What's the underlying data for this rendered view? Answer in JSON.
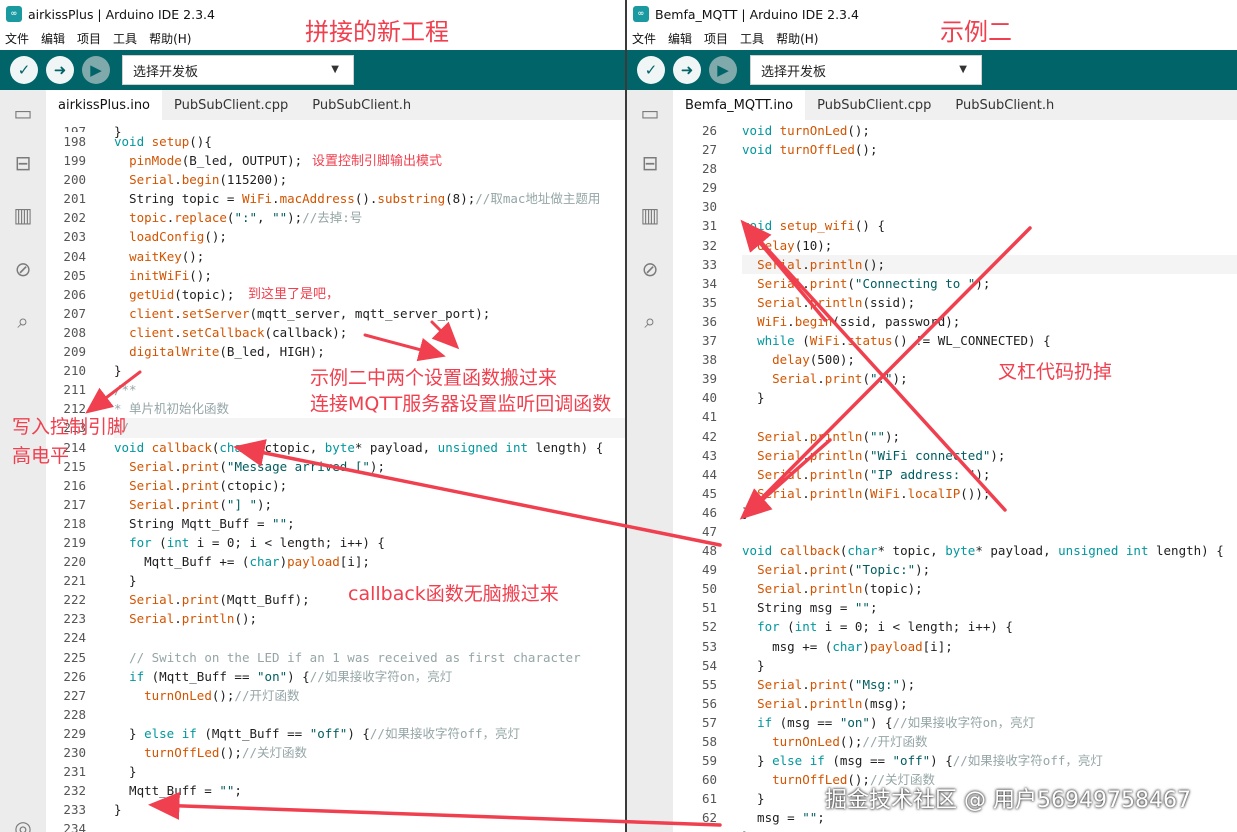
{
  "left_window": {
    "title": "airkissPlus | Arduino IDE 2.3.4",
    "menu": [
      "文件",
      "编辑",
      "项目",
      "工具",
      "帮助(H)"
    ],
    "board_selector": "选择开发板",
    "tabs": [
      "airkissPlus.ino",
      "PubSubClient.cpp",
      "PubSubClient.h"
    ],
    "active_tab": 0,
    "first_partial_line": "197",
    "lines": [
      {
        "n": "198",
        "html": "<span class=\"ty\">void</span> <span class=\"fn\">setup</span>(){"
      },
      {
        "n": "199",
        "html": "  <span class=\"fn\">pinMode</span>(B_led, OUTPUT);"
      },
      {
        "n": "200",
        "html": "  <span class=\"fn\">Serial</span>.<span class=\"fn\">begin</span>(115200);"
      },
      {
        "n": "201",
        "html": "  String topic = <span class=\"fn\">WiFi</span>.<span class=\"fn\">macAddress</span>().<span class=\"fn\">substring</span>(8);<span class=\"cm\">//取mac地址做主题用</span>"
      },
      {
        "n": "202",
        "html": "  <span class=\"fn\">topic</span>.<span class=\"fn\">replace</span>(<span class=\"st\">\":\"</span>, <span class=\"st\">\"\"</span>);<span class=\"cm\">//去掉:号</span>"
      },
      {
        "n": "203",
        "html": "  <span class=\"fn\">loadConfig</span>();"
      },
      {
        "n": "204",
        "html": "  <span class=\"fn\">waitKey</span>();"
      },
      {
        "n": "205",
        "html": "  <span class=\"fn\">initWiFi</span>();"
      },
      {
        "n": "206",
        "html": "  <span class=\"fn\">getUid</span>(topic);"
      },
      {
        "n": "207",
        "html": "  <span class=\"fn\">client</span>.<span class=\"fn\">setServer</span>(mqtt_server, mqtt_server_port);"
      },
      {
        "n": "208",
        "html": "  <span class=\"fn\">client</span>.<span class=\"fn\">setCallback</span>(callback);"
      },
      {
        "n": "209",
        "html": "  <span class=\"fn\">digitalWrite</span>(B_led, HIGH);"
      },
      {
        "n": "210",
        "html": "}"
      },
      {
        "n": "211",
        "html": "<span class=\"cm\">/**</span>"
      },
      {
        "n": "212",
        "html": "<span class=\"cm\">* 单片机初始化函数</span>"
      },
      {
        "n": "213",
        "html": "<span class=\"cm\">*/</span>"
      },
      {
        "n": "214",
        "html": "<span class=\"ty\">void</span> <span class=\"fn\">callback</span>(<span class=\"ty\">char</span>* ctopic, <span class=\"ty\">byte</span>* payload, <span class=\"ty\">unsigned</span> <span class=\"ty\">int</span> length) {"
      },
      {
        "n": "215",
        "html": "  <span class=\"fn\">Serial</span>.<span class=\"fn\">print</span>(<span class=\"st\">\"Message arrived [\"</span>);"
      },
      {
        "n": "216",
        "html": "  <span class=\"fn\">Serial</span>.<span class=\"fn\">print</span>(ctopic);"
      },
      {
        "n": "217",
        "html": "  <span class=\"fn\">Serial</span>.<span class=\"fn\">print</span>(<span class=\"st\">\"] \"</span>);"
      },
      {
        "n": "218",
        "html": "  String Mqtt_Buff = <span class=\"st\">\"\"</span>;"
      },
      {
        "n": "219",
        "html": "  <span class=\"kw\">for</span> (<span class=\"ty\">int</span> i = 0; i &lt; length; i++) {"
      },
      {
        "n": "220",
        "html": "    Mqtt_Buff += (<span class=\"ty\">char</span>)<span class=\"fn\">payload</span>[i];"
      },
      {
        "n": "221",
        "html": "  }"
      },
      {
        "n": "222",
        "html": "  <span class=\"fn\">Serial</span>.<span class=\"fn\">print</span>(Mqtt_Buff);"
      },
      {
        "n": "223",
        "html": "  <span class=\"fn\">Serial</span>.<span class=\"fn\">println</span>();"
      },
      {
        "n": "224",
        "html": ""
      },
      {
        "n": "225",
        "html": "  <span class=\"cm\">// Switch on the LED if an 1 was received as first character</span>"
      },
      {
        "n": "226",
        "html": "  <span class=\"kw\">if</span> (Mqtt_Buff == <span class=\"st\">\"on\"</span>) {<span class=\"cm\">//如果接收字符on，亮灯</span>"
      },
      {
        "n": "227",
        "html": "    <span class=\"fn\">turnOnLed</span>();<span class=\"cm\">//开灯函数</span>"
      },
      {
        "n": "228",
        "html": ""
      },
      {
        "n": "229",
        "html": "  } <span class=\"kw\">else if</span> (Mqtt_Buff == <span class=\"st\">\"off\"</span>) {<span class=\"cm\">//如果接收字符off，亮灯</span>"
      },
      {
        "n": "230",
        "html": "    <span class=\"fn\">turnOffLed</span>();<span class=\"cm\">//关灯函数</span>"
      },
      {
        "n": "231",
        "html": "  }"
      },
      {
        "n": "232",
        "html": "  Mqtt_Buff = <span class=\"st\">\"\"</span>;"
      },
      {
        "n": "233",
        "html": "}"
      },
      {
        "n": "234",
        "html": ""
      }
    ]
  },
  "right_window": {
    "title": "Bemfa_MQTT | Arduino IDE 2.3.4",
    "menu": [
      "文件",
      "编辑",
      "项目",
      "工具",
      "帮助(H)"
    ],
    "board_selector": "选择开发板",
    "tabs": [
      "Bemfa_MQTT.ino",
      "PubSubClient.cpp",
      "PubSubClient.h"
    ],
    "active_tab": 0,
    "lines": [
      {
        "n": "26",
        "html": "<span class=\"ty\">void</span> <span class=\"fn\">turnOnLed</span>();"
      },
      {
        "n": "27",
        "html": "<span class=\"ty\">void</span> <span class=\"fn\">turnOffLed</span>();"
      },
      {
        "n": "28",
        "html": ""
      },
      {
        "n": "29",
        "html": ""
      },
      {
        "n": "30",
        "html": ""
      },
      {
        "n": "31",
        "html": "<span class=\"ty\">void</span> <span class=\"fn\">setup_wifi</span>() {"
      },
      {
        "n": "32",
        "html": "  <span class=\"fn\">delay</span>(10);"
      },
      {
        "n": "33",
        "html": "  <span class=\"fn\">Serial</span>.<span class=\"fn\">println</span>();"
      },
      {
        "n": "34",
        "html": "  <span class=\"fn\">Serial</span>.<span class=\"fn\">print</span>(<span class=\"st\">\"Connecting to \"</span>);"
      },
      {
        "n": "35",
        "html": "  <span class=\"fn\">Serial</span>.<span class=\"fn\">println</span>(ssid);"
      },
      {
        "n": "36",
        "html": "  <span class=\"fn\">WiFi</span>.<span class=\"fn\">begin</span>(ssid, password);"
      },
      {
        "n": "37",
        "html": "  <span class=\"kw\">while</span> (<span class=\"fn\">WiFi</span>.<span class=\"fn\">status</span>() != WL_CONNECTED) {"
      },
      {
        "n": "38",
        "html": "    <span class=\"fn\">delay</span>(500);"
      },
      {
        "n": "39",
        "html": "    <span class=\"fn\">Serial</span>.<span class=\"fn\">print</span>(<span class=\"st\">\".\"</span>);"
      },
      {
        "n": "40",
        "html": "  }"
      },
      {
        "n": "41",
        "html": ""
      },
      {
        "n": "42",
        "html": "  <span class=\"fn\">Serial</span>.<span class=\"fn\">println</span>(<span class=\"st\">\"\"</span>);"
      },
      {
        "n": "43",
        "html": "  <span class=\"fn\">Serial</span>.<span class=\"fn\">println</span>(<span class=\"st\">\"WiFi connected\"</span>);"
      },
      {
        "n": "44",
        "html": "  <span class=\"fn\">Serial</span>.<span class=\"fn\">println</span>(<span class=\"st\">\"IP address: \"</span>);"
      },
      {
        "n": "45",
        "html": "  <span class=\"fn\">Serial</span>.<span class=\"fn\">println</span>(<span class=\"fn\">WiFi</span>.<span class=\"fn\">localIP</span>());"
      },
      {
        "n": "46",
        "html": "}"
      },
      {
        "n": "47",
        "html": ""
      },
      {
        "n": "48",
        "html": "<span class=\"ty\">void</span> <span class=\"fn\">callback</span>(<span class=\"ty\">char</span>* topic, <span class=\"ty\">byte</span>* payload, <span class=\"ty\">unsigned</span> <span class=\"ty\">int</span> length) {"
      },
      {
        "n": "49",
        "html": "  <span class=\"fn\">Serial</span>.<span class=\"fn\">print</span>(<span class=\"st\">\"Topic:\"</span>);"
      },
      {
        "n": "50",
        "html": "  <span class=\"fn\">Serial</span>.<span class=\"fn\">println</span>(topic);"
      },
      {
        "n": "51",
        "html": "  String msg = <span class=\"st\">\"\"</span>;"
      },
      {
        "n": "52",
        "html": "  <span class=\"kw\">for</span> (<span class=\"ty\">int</span> i = 0; i &lt; length; i++) {"
      },
      {
        "n": "53",
        "html": "    msg += (<span class=\"ty\">char</span>)<span class=\"fn\">payload</span>[i];"
      },
      {
        "n": "54",
        "html": "  }"
      },
      {
        "n": "55",
        "html": "  <span class=\"fn\">Serial</span>.<span class=\"fn\">print</span>(<span class=\"st\">\"Msg:\"</span>);"
      },
      {
        "n": "56",
        "html": "  <span class=\"fn\">Serial</span>.<span class=\"fn\">println</span>(msg);"
      },
      {
        "n": "57",
        "html": "  <span class=\"kw\">if</span> (msg == <span class=\"st\">\"on\"</span>) {<span class=\"cm\">//如果接收字符on，亮灯</span>"
      },
      {
        "n": "58",
        "html": "    <span class=\"fn\">turnOnLed</span>();<span class=\"cm\">//开灯函数</span>"
      },
      {
        "n": "59",
        "html": "  } <span class=\"kw\">else if</span> (msg == <span class=\"st\">\"off\"</span>) {<span class=\"cm\">//如果接收字符off，亮灯</span>"
      },
      {
        "n": "60",
        "html": "    <span class=\"fn\">turnOffLed</span>();<span class=\"cm\">//关灯函数</span>"
      },
      {
        "n": "61",
        "html": "  }"
      },
      {
        "n": "62",
        "html": "  msg = <span class=\"st\">\"\"</span>;"
      },
      {
        "n": "63",
        "html": "}"
      }
    ]
  },
  "annotations": {
    "left_heading": "拼接的新工程",
    "right_heading": "示例二",
    "pin_mode_note": "设置控制引脚输出模式",
    "getuid_note": "到这里了是吧，",
    "move_setters_line1": "示例二中两个设置函数搬过来",
    "move_setters_line2": "连接MQTT服务器设置监听回调函数",
    "write_pin_line1": "写入控制引脚",
    "write_pin_line2": "高电平",
    "callback_note": "callback函数无脑搬过来",
    "cross_out_note": "叉杠代码扔掉",
    "color": "#f0404f"
  },
  "watermark": "掘金技术社区 @ 用户56949758467"
}
